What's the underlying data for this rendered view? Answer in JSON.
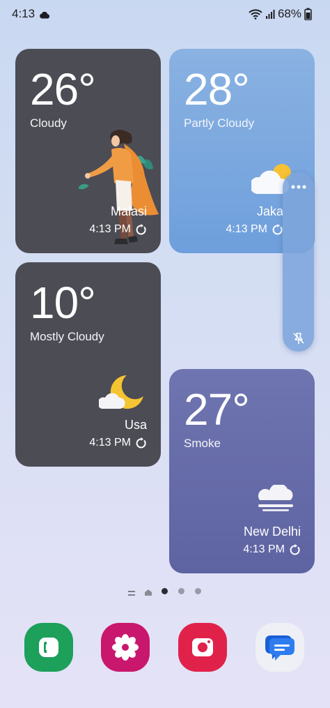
{
  "status_bar": {
    "time": "4:13",
    "battery": "68%",
    "weather_icon": "cloud-icon",
    "wifi_icon": "wifi-icon",
    "signal_icon": "signal-icon",
    "battery_icon": "battery-icon"
  },
  "widgets": [
    {
      "temp": "26°",
      "condition": "Cloudy",
      "city": "Malasi",
      "updated": "4:13 PM",
      "illustration": "person-in-wind-illustration",
      "bg": "#4c4c55"
    },
    {
      "temp": "28°",
      "condition": "Partly Cloudy",
      "city": "Jaka",
      "updated": "4:13 PM",
      "illustration": "sun-behind-cloud-icon",
      "bg": "#7aa6de"
    },
    {
      "temp": "10°",
      "condition": "Mostly Cloudy",
      "city": "Usa",
      "updated": "4:13 PM",
      "illustration": "moon-with-cloud-icon",
      "bg": "#4c4c55"
    },
    {
      "temp": "27°",
      "condition": "Smoke",
      "city": "New Delhi",
      "updated": "4:13 PM",
      "illustration": "smoke-cloud-icon",
      "bg": "#6a6faa"
    }
  ],
  "edge_panel": {
    "more_icon": "more-options-icon",
    "pin_icon": "pin-off-icon"
  },
  "page_indicator": {
    "pages": 5,
    "active_index": 2
  },
  "dock": [
    {
      "app": "Phone",
      "icon": "phone-icon",
      "color": "#1ca05a"
    },
    {
      "app": "Gallery",
      "icon": "blossom-icon",
      "color": "#c9176d"
    },
    {
      "app": "Camera",
      "icon": "camera-icon",
      "color": "#e0224b"
    },
    {
      "app": "Messages",
      "icon": "messages-icon",
      "color": "#1a73e8"
    }
  ]
}
